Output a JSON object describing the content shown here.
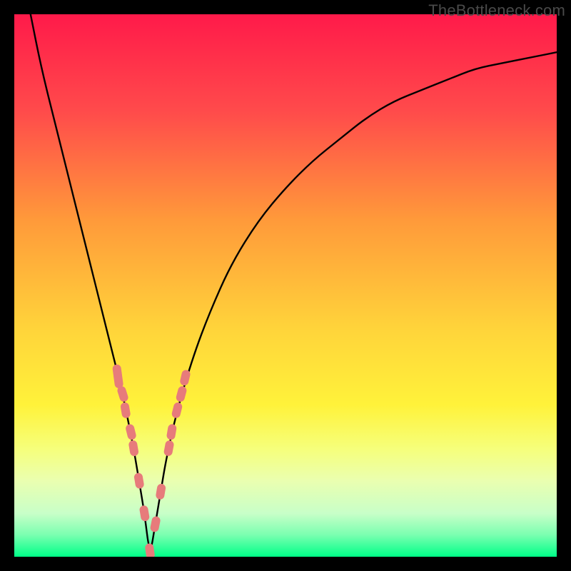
{
  "watermark": "TheBottleneck.com",
  "colors": {
    "frame": "#000000",
    "gradient_stops": [
      {
        "pct": 0,
        "color": "#ff1a4a"
      },
      {
        "pct": 18,
        "color": "#ff4b4b"
      },
      {
        "pct": 38,
        "color": "#ff9a3a"
      },
      {
        "pct": 58,
        "color": "#ffd43a"
      },
      {
        "pct": 72,
        "color": "#fff23a"
      },
      {
        "pct": 80,
        "color": "#f6ff7a"
      },
      {
        "pct": 86,
        "color": "#eaffb0"
      },
      {
        "pct": 92,
        "color": "#c8ffc8"
      },
      {
        "pct": 96,
        "color": "#7affb0"
      },
      {
        "pct": 100,
        "color": "#00ff88"
      }
    ],
    "curve": "#000000",
    "marker_fill": "#e77b7b",
    "marker_stroke": "#c85a5a"
  },
  "chart_data": {
    "type": "line",
    "title": "",
    "xlabel": "",
    "ylabel": "",
    "xlim": [
      0,
      100
    ],
    "ylim": [
      0,
      100
    ],
    "x_optimum": 25,
    "series": [
      {
        "name": "bottleneck-curve",
        "x": [
          3,
          5,
          8,
          10,
          12,
          14,
          16,
          18,
          20,
          22,
          23,
          24,
          25,
          26,
          27,
          28,
          30,
          33,
          36,
          40,
          45,
          50,
          55,
          60,
          65,
          70,
          75,
          80,
          85,
          90,
          95,
          100
        ],
        "values": [
          100,
          90,
          78,
          70,
          62,
          54,
          46,
          38,
          30,
          20,
          14,
          8,
          0,
          6,
          12,
          18,
          27,
          37,
          45,
          54,
          62,
          68,
          73,
          77,
          81,
          84,
          86,
          88,
          90,
          91,
          92,
          93
        ]
      }
    ],
    "markers": {
      "name": "highlighted-points",
      "x": [
        19.0,
        19.2,
        20.0,
        20.5,
        21.5,
        22.0,
        23.0,
        24.0,
        25.0,
        26.0,
        27.0,
        28.5,
        29.0,
        30.0,
        30.8,
        31.5
      ],
      "values": [
        34.0,
        32.5,
        30.0,
        27.0,
        23.0,
        20.0,
        14.0,
        8.0,
        1.0,
        6.0,
        12.0,
        20.0,
        23.0,
        27.0,
        30.0,
        33.0
      ]
    }
  }
}
